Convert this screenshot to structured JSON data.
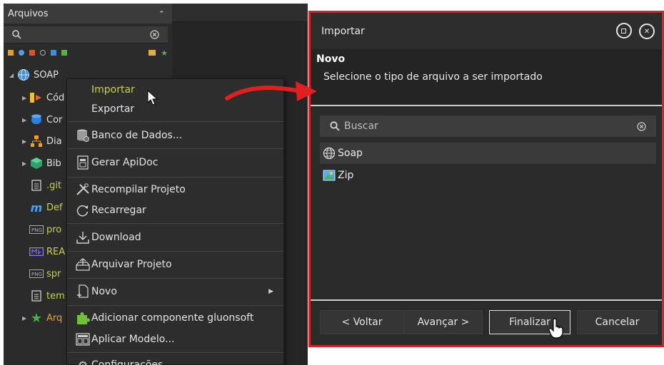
{
  "files_panel": {
    "title": "Arquivos",
    "search_placeholder": "",
    "tree": [
      {
        "label": "SOAP",
        "icon": "globe-icon",
        "expanded": true
      },
      {
        "label": "Cód",
        "icon": "code-folder-icon"
      },
      {
        "label": "Cor",
        "icon": "database-icon"
      },
      {
        "label": "Dia",
        "icon": "diagram-icon"
      },
      {
        "label": "Bib",
        "icon": "library-cube-icon"
      },
      {
        "label": ".git",
        "icon": "file-icon"
      },
      {
        "label": "Def",
        "icon": "m-icon"
      },
      {
        "label": "pro",
        "icon": "png-icon"
      },
      {
        "label": "REA",
        "icon": "readme-icon"
      },
      {
        "label": "spr",
        "icon": "png-icon"
      },
      {
        "label": "tem",
        "icon": "file-icon"
      },
      {
        "label": "Arq",
        "icon": "star-icon"
      }
    ]
  },
  "context_menu": {
    "items": [
      {
        "label": "Importar",
        "icon": ""
      },
      {
        "label": "Exportar",
        "icon": ""
      },
      {
        "label": "Banco de Dados...",
        "icon": "database-icon"
      },
      {
        "label": "Gerar ApiDoc",
        "icon": "document-icon"
      },
      {
        "label": "Recompilar Projeto",
        "icon": "tools-icon"
      },
      {
        "label": "Recarregar",
        "icon": "reload-icon"
      },
      {
        "label": "Download",
        "icon": "download-icon"
      },
      {
        "label": "Arquivar Projeto",
        "icon": "archive-icon"
      },
      {
        "label": "Novo",
        "icon": "new-file-icon",
        "submenu": true
      },
      {
        "label": "Adicionar componente gluonsoft",
        "icon": "puzzle-icon"
      },
      {
        "label": "Aplicar Modelo...",
        "icon": "template-icon"
      },
      {
        "label": "Configurações",
        "icon": "gear-icon"
      }
    ]
  },
  "dialog": {
    "title": "Importar",
    "section_title": "Novo",
    "description": "Selecione o tipo de arquivo a ser importado",
    "search_placeholder": "Buscar",
    "types": [
      {
        "label": "Soap",
        "icon": "globe-icon",
        "selected": true
      },
      {
        "label": "Zip",
        "icon": "zip-image-icon",
        "selected": false
      }
    ],
    "buttons": {
      "back": "< Voltar",
      "next": "Avançar >",
      "finish": "Finalizar",
      "cancel": "Cancelar"
    }
  },
  "colors": {
    "highlight_border": "#d2232a",
    "accent_yellow": "#c9d14a"
  }
}
